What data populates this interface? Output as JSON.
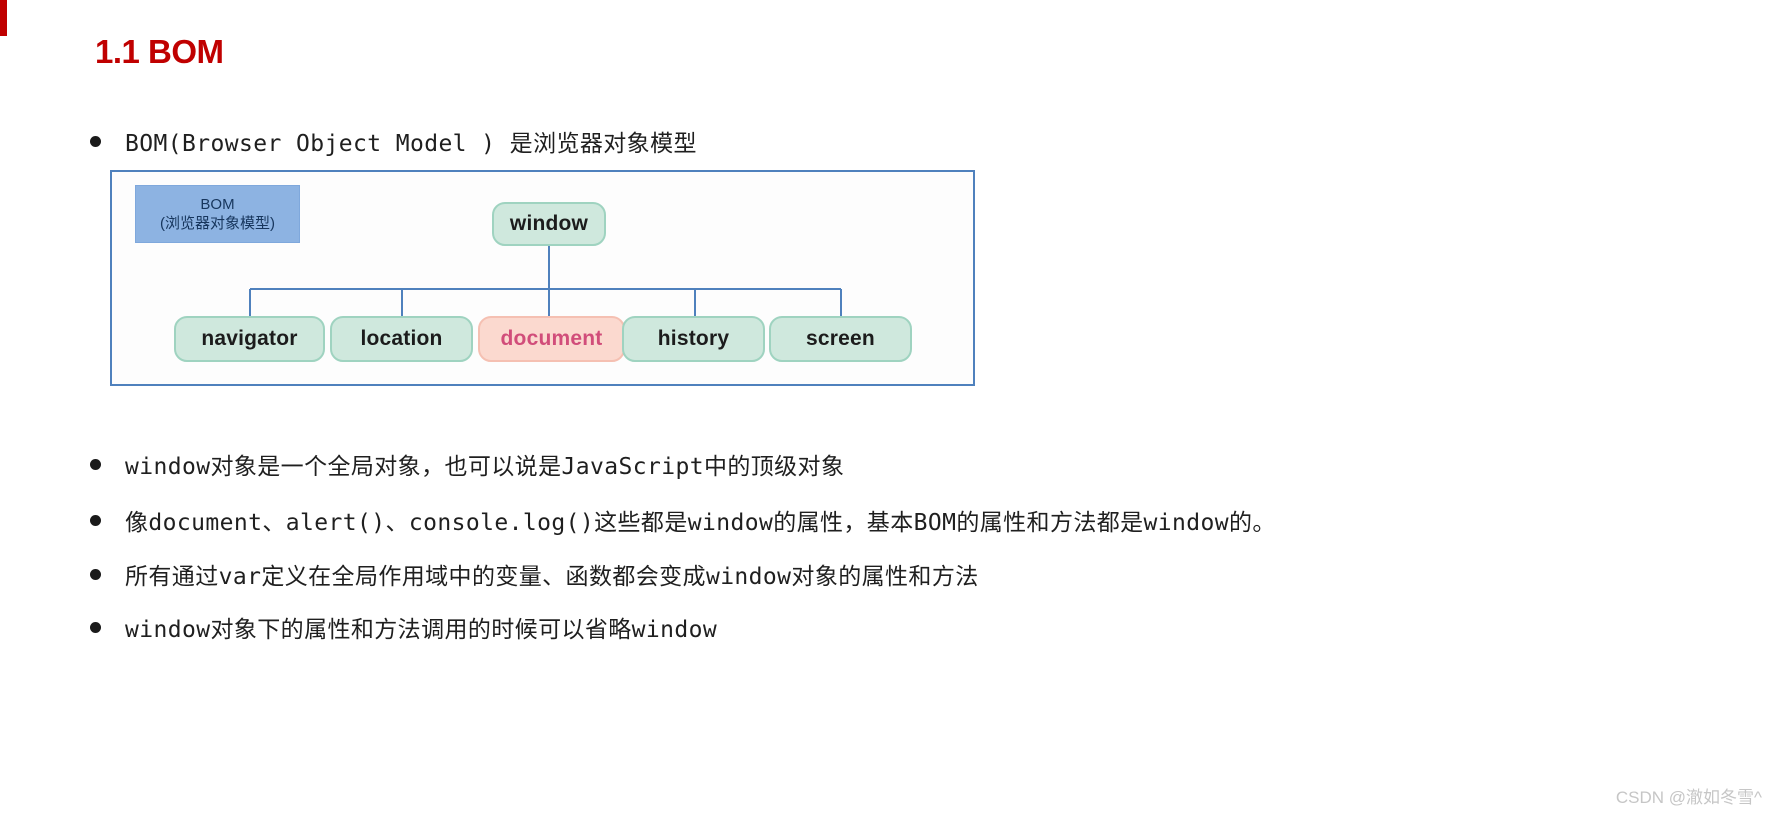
{
  "heading": "1.1 BOM",
  "bullets": [
    {
      "text": "BOM(Browser Object Model ) 是浏览器对象模型",
      "mono": true
    },
    {
      "text": "window对象是一个全局对象，也可以说是JavaScript中的顶级对象",
      "mono": true
    },
    {
      "text": "像document、alert()、console.log()这些都是window的属性，基本BOM的属性和方法都是window的。",
      "mono": true
    },
    {
      "text": "所有通过var定义在全局作用域中的变量、函数都会变成window对象的属性和方法",
      "mono": true
    },
    {
      "text": "window对象下的属性和方法调用的时候可以省略window",
      "mono": true
    }
  ],
  "diagram": {
    "legend": {
      "line1": "BOM",
      "line2": "(浏览器对象模型)",
      "fill": "#8db3e2"
    },
    "root": {
      "label": "window",
      "fill": "#cfe8dd"
    },
    "children": [
      {
        "label": "navigator",
        "fill": "#cfe8dd",
        "text_color": "#1c1c1c"
      },
      {
        "label": "location",
        "fill": "#cfe8dd",
        "text_color": "#1c1c1c"
      },
      {
        "label": "document",
        "fill": "#fbd9cf",
        "text_color": "#d14d7a"
      },
      {
        "label": "history",
        "fill": "#cfe8dd",
        "text_color": "#1c1c1c"
      },
      {
        "label": "screen",
        "fill": "#cfe8dd",
        "text_color": "#1c1c1c"
      }
    ],
    "border_color": "#4f81bd",
    "connector_color": "#4f81bd"
  },
  "watermark": "CSDN @澈如冬雪^",
  "accent_color": "#c00000"
}
